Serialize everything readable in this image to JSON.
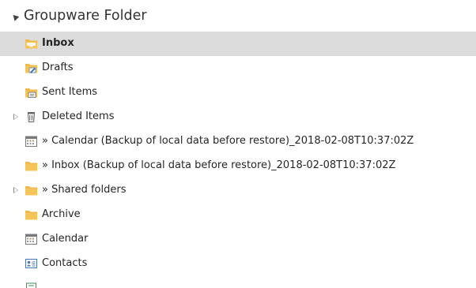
{
  "group": {
    "title": "Groupware Folder",
    "expanded": true
  },
  "folders": [
    {
      "label": "Inbox",
      "icon": "inbox-folder-icon",
      "selected": true
    },
    {
      "label": "Drafts",
      "icon": "drafts-folder-icon"
    },
    {
      "label": "Sent Items",
      "icon": "sent-items-folder-icon"
    },
    {
      "label": "Deleted Items",
      "icon": "deleted-items-trash-icon",
      "has_children": true,
      "expanded": false
    },
    {
      "label": "» Calendar (Backup of local data before restore)_2018-02-08T10:37:02Z",
      "icon": "calendar-folder-icon"
    },
    {
      "label": "» Inbox (Backup of local data before restore)_2018-02-08T10:37:02Z",
      "icon": "folder-icon"
    },
    {
      "label": "» Shared folders",
      "icon": "folder-icon",
      "has_children": true,
      "expanded": false
    },
    {
      "label": "Archive",
      "icon": "folder-icon"
    },
    {
      "label": "Calendar",
      "icon": "calendar-folder-icon"
    },
    {
      "label": "Contacts",
      "icon": "contacts-folder-icon"
    }
  ],
  "colors": {
    "selected_background": "#dcdcdc",
    "folder_yellow": "#f5c45a",
    "text": "#262626"
  }
}
